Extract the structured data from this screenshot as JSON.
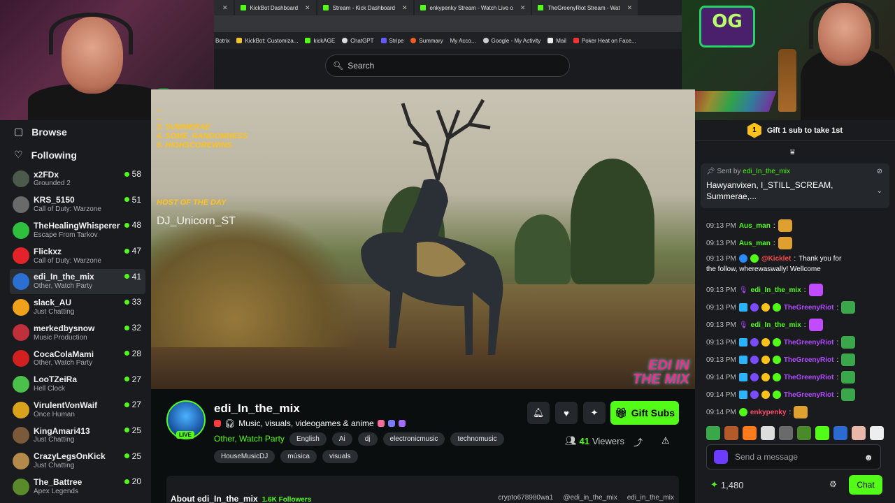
{
  "browser": {
    "tabs": [
      {
        "label": "KickBot Dashboard"
      },
      {
        "label": "Stream - Kick Dashboard"
      },
      {
        "label": "enkypenky Stream - Watch Live o"
      },
      {
        "label": "TheGreenyRiot Stream - Wat"
      }
    ],
    "bookmarks": [
      "Botrix",
      "KickBot: Customiza...",
      "kickAGE",
      "ChatGPT",
      "Stripe",
      "Summary",
      "My Acco...",
      "Google - My Activity",
      "Mail",
      "Poker Heat on Face..."
    ]
  },
  "search": {
    "placeholder": "Search"
  },
  "sidebar": {
    "browse": "Browse",
    "following": "Following",
    "channels": [
      {
        "name": "x2FDx",
        "category": "Grounded 2",
        "viewers": "58",
        "color": "#4b5a4a"
      },
      {
        "name": "KRS_5150",
        "category": "Call of Duty: Warzone",
        "viewers": "51",
        "color": "#6a6a6a"
      },
      {
        "name": "TheHealingWhisperer",
        "category": "Escape From Tarkov",
        "viewers": "48",
        "color": "#2fbf3f"
      },
      {
        "name": "Flickxz",
        "category": "Call of Duty: Warzone",
        "viewers": "47",
        "color": "#e2242a"
      },
      {
        "name": "edi_In_the_mix",
        "category": "Other, Watch Party",
        "viewers": "41",
        "color": "#2a6fd1"
      },
      {
        "name": "slack_AU",
        "category": "Just Chatting",
        "viewers": "33",
        "color": "#f0a21a"
      },
      {
        "name": "merkedbysnow",
        "category": "Music Production",
        "viewers": "32",
        "color": "#c0303a"
      },
      {
        "name": "CocaColaMami",
        "category": "Other, Watch Party",
        "viewers": "28",
        "color": "#d02020"
      },
      {
        "name": "LooTZeiRa",
        "category": "Hell Clock",
        "viewers": "27",
        "color": "#4bc04b"
      },
      {
        "name": "VirulentVonWaif",
        "category": "Once Human",
        "viewers": "27",
        "color": "#d9a21c"
      },
      {
        "name": "KingAmari413",
        "category": "Just Chatting",
        "viewers": "25",
        "color": "#7a5a3a"
      },
      {
        "name": "CrazyLegsOnKick",
        "category": "Just Chatting",
        "viewers": "25",
        "color": "#b48a4a"
      },
      {
        "name": "The_Battree",
        "category": "Apex Legends",
        "viewers": "20",
        "color": "#5a8a2a"
      }
    ]
  },
  "video": {
    "overlay_list": [
      "...",
      "...",
      "3. SUMMERAE",
      "4. SOME_RANDOMNESS",
      "5. HIGHSCOREWINS"
    ],
    "host_label": "HOST OF THE DAY",
    "host_name": "DJ_Unicorn_ST",
    "watermark_line1": "EDI IN",
    "watermark_line2": "THE MIX"
  },
  "stream": {
    "name": "edi_In_the_mix",
    "live": "LIVE",
    "title": "Music, visuals, videogames & anime",
    "category": "Other, Watch Party",
    "tags_row1": [
      "English",
      "Ai",
      "dj",
      "electronicmusic",
      "technomusic"
    ],
    "tags_row2": [
      "HouseMusicDJ",
      "música",
      "visuals"
    ],
    "gift_label": "Gift Subs",
    "viewers": "41",
    "viewers_label": "Viewers",
    "about": "About edi_In_the_mix",
    "followers": "1.6K Followers",
    "socials": [
      "crypto678980wa1",
      "@edi_in_the_mix",
      "edi_in_the_mix"
    ]
  },
  "chat": {
    "gift_banner": "Gift 1 sub to take 1st",
    "gift_rank": "1",
    "pinned_sent_by": "Sent by",
    "pinned_user": "edi_In_the_mix",
    "pinned_text": "Hawyanvixen, I_STILL_SCREAM, Summerae,...",
    "messages": [
      {
        "ts": "09:13 PM",
        "user": "Aus_man",
        "color": "#53fc18",
        "text": ""
      },
      {
        "ts": "09:13 PM",
        "user": "Aus_man",
        "color": "#53fc18",
        "text": ""
      },
      {
        "ts": "09:13 PM",
        "user": "@Kicklet",
        "color": "#ff4b4b",
        "text": "Thank you for"
      },
      {
        "ts": "",
        "user": "",
        "color": "#ffffff",
        "text": "the follow, wherewaswally! Wellcome"
      },
      {
        "ts": "09:13 PM",
        "user": "edi_In_the_mix",
        "color": "#53fc18",
        "text": ""
      },
      {
        "ts": "09:13 PM",
        "user": "TheGreenyRiot",
        "color": "#b14bff",
        "text": ""
      },
      {
        "ts": "09:13 PM",
        "user": "edi_In_the_mix",
        "color": "#53fc18",
        "text": ""
      },
      {
        "ts": "09:13 PM",
        "user": "TheGreenyRiot",
        "color": "#b14bff",
        "text": ""
      },
      {
        "ts": "09:13 PM",
        "user": "TheGreenyRiot",
        "color": "#b14bff",
        "text": ""
      },
      {
        "ts": "09:14 PM",
        "user": "TheGreenyRiot",
        "color": "#b14bff",
        "text": ""
      },
      {
        "ts": "09:14 PM",
        "user": "TheGreenyRiot",
        "color": "#b14bff",
        "text": ""
      },
      {
        "ts": "09:14 PM",
        "user": "enkypenky",
        "color": "#ff4b6a",
        "text": ""
      }
    ],
    "input_placeholder": "Send a message",
    "points": "1,480",
    "chat_button": "Chat"
  }
}
